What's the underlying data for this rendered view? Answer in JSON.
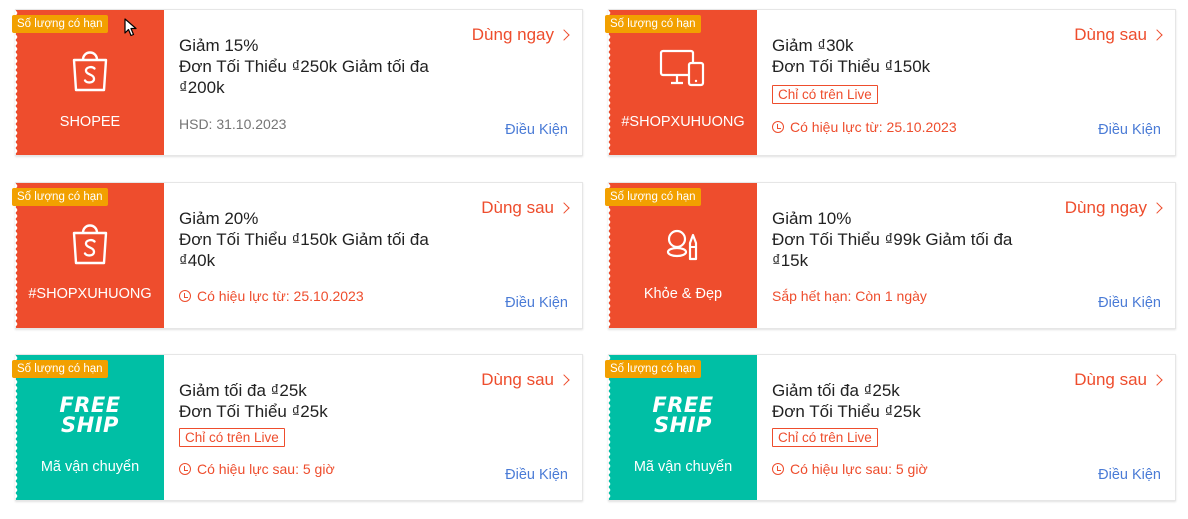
{
  "colors": {
    "shopee_orange": "#ee4d2d",
    "freeship_teal": "#00bfa5",
    "badge_amber": "#f2a000",
    "link_blue": "#4a7bd6"
  },
  "vouchers": [
    {
      "badge": "Số lượng có hạn",
      "icon": "shopee-bag-icon",
      "left_label": "SHOPEE",
      "title_line1": "Giảm 15%",
      "title_line2": "Đơn Tối Thiểu ₫250k Giảm tối đa",
      "title_line3": "₫200k",
      "action": "Dùng ngay",
      "meta": "HSD: 31.10.2023",
      "conditions": "Điều Kiện"
    },
    {
      "badge": "Số lượng có hạn",
      "icon": "devices-icon",
      "left_label": "#SHOPXUHUONG",
      "title_line1": "Giảm ₫30k",
      "title_line2": "Đơn Tối Thiểu ₫150k",
      "tag": "Chỉ có trên Live",
      "action": "Dùng sau",
      "meta": "Có hiệu lực từ: 25.10.2023",
      "conditions": "Điều Kiện"
    },
    {
      "badge": "Số lượng có hạn",
      "icon": "shopee-bag-icon",
      "left_label": "#SHOPXUHUONG",
      "title_line1": "Giảm 20%",
      "title_line2": "Đơn Tối Thiểu ₫150k Giảm tối đa",
      "title_line3": "₫40k",
      "action": "Dùng sau",
      "meta": "Có hiệu lực từ: 25.10.2023",
      "conditions": "Điều Kiện"
    },
    {
      "badge": "Số lượng có hạn",
      "icon": "cosmetics-icon",
      "left_label": "Khỏe & Đẹp",
      "title_line1": "Giảm 10%",
      "title_line2": "Đơn Tối Thiểu ₫99k Giảm tối đa",
      "title_line3": "₫15k",
      "action": "Dùng ngay",
      "meta": "Sắp hết hạn: Còn 1 ngày",
      "conditions": "Điều Kiện"
    },
    {
      "badge": "Số lượng có hạn",
      "logo_line1": "FREE",
      "logo_line2": "SHIP",
      "left_label": "Mã vận chuyển",
      "title_line1": "Giảm tối đa ₫25k",
      "title_line2": "Đơn Tối Thiểu ₫25k",
      "tag": "Chỉ có trên Live",
      "action": "Dùng sau",
      "meta": "Có hiệu lực sau: 5 giờ",
      "conditions": "Điều Kiện"
    },
    {
      "badge": "Số lượng có hạn",
      "logo_line1": "FREE",
      "logo_line2": "SHIP",
      "left_label": "Mã vận chuyển",
      "title_line1": "Giảm tối đa ₫25k",
      "title_line2": "Đơn Tối Thiểu ₫25k",
      "tag": "Chỉ có trên Live",
      "action": "Dùng sau",
      "meta": "Có hiệu lực sau: 5 giờ",
      "conditions": "Điều Kiện"
    }
  ]
}
